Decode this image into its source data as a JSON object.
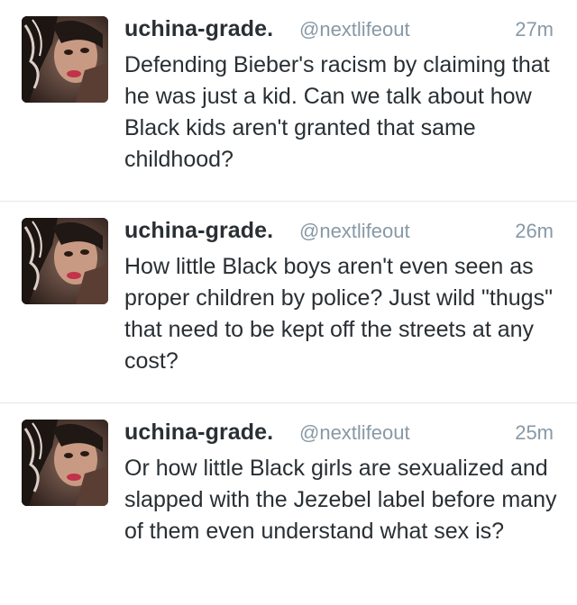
{
  "tweets": [
    {
      "name": "uchina-grade.",
      "handle": "@nextlifeout",
      "time": "27m",
      "text": "Defending Bieber's racism by claiming that he was just a kid. Can we talk about how Black kids aren't granted that same childhood?"
    },
    {
      "name": "uchina-grade.",
      "handle": "@nextlifeout",
      "time": "26m",
      "text": "How little Black boys aren't even seen as proper children by police? Just wild \"thugs\" that need to be kept off the streets at any cost?"
    },
    {
      "name": "uchina-grade.",
      "handle": "@nextlifeout",
      "time": "25m",
      "text": "Or how little Black girls are sexualized and slapped with the Jezebel label before many of them even understand what sex is?"
    }
  ],
  "colors": {
    "text": "#292f33",
    "muted": "#8899a6",
    "divider": "#e1e8ed",
    "background": "#ffffff"
  }
}
